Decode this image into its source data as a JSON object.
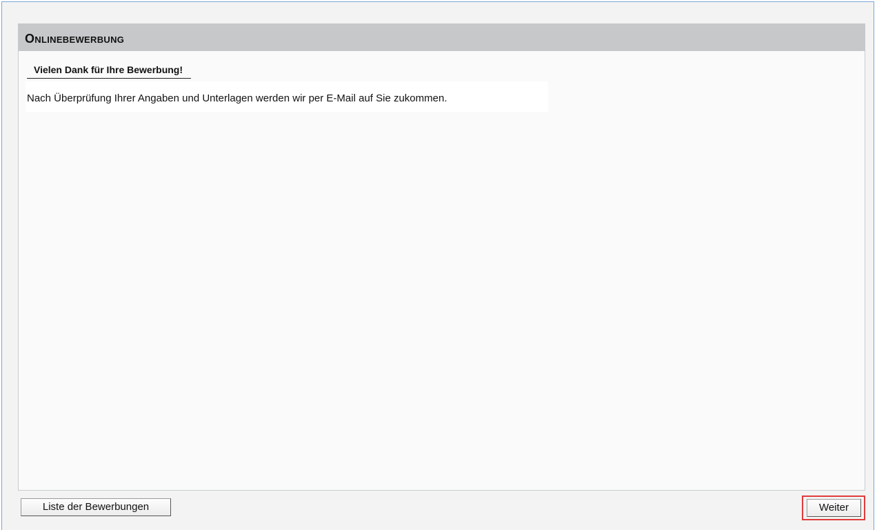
{
  "panel": {
    "title": "Onlinebewerbung"
  },
  "content": {
    "heading": "Vielen Dank für Ihre Bewerbung!",
    "message": "Nach Überprüfung Ihrer Angaben und Unterlagen werden wir per E-Mail auf Sie zukommen."
  },
  "footer": {
    "back_label": "Liste der Bewerbungen",
    "next_label": "Weiter"
  },
  "colors": {
    "header_bg": "#c6c8ca",
    "highlight": "#e03a3a",
    "frame_border": "#7aa6d8"
  }
}
